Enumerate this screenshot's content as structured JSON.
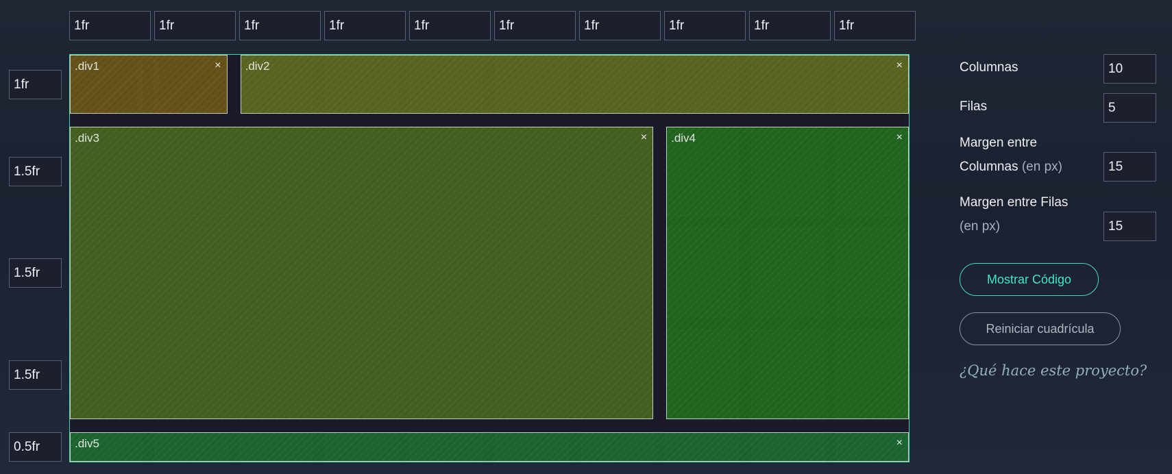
{
  "columns": {
    "templates": [
      "1fr",
      "1fr",
      "1fr",
      "1fr",
      "1fr",
      "1fr",
      "1fr",
      "1fr",
      "1fr",
      "1fr"
    ]
  },
  "rows": {
    "templates": [
      "1fr",
      "1.5fr",
      "1.5fr",
      "1.5fr",
      "0.5fr"
    ]
  },
  "grid": {
    "areas": [
      {
        "label": ".div1",
        "close": "×",
        "color": "#6a5618",
        "col": [
          1,
          2
        ],
        "row": [
          1,
          1
        ]
      },
      {
        "label": ".div2",
        "close": "×",
        "color": "#5c6a1f",
        "col": [
          3,
          10
        ],
        "row": [
          1,
          1
        ]
      },
      {
        "label": ".div3",
        "close": "×",
        "color": "#47651e",
        "col": [
          1,
          7
        ],
        "row": [
          2,
          4
        ]
      },
      {
        "label": ".div4",
        "close": "×",
        "color": "#216a1f",
        "col": [
          8,
          10
        ],
        "row": [
          2,
          4
        ]
      },
      {
        "label": ".div5",
        "close": "×",
        "color": "#1b6a30",
        "col": [
          1,
          10
        ],
        "row": [
          5,
          5
        ]
      }
    ]
  },
  "settings": {
    "columns_label": "Columnas",
    "columns_value": "10",
    "rows_label": "Filas",
    "rows_value": "5",
    "col_gap_label_line1": "Margen entre",
    "col_gap_label_line2": "Columnas",
    "col_gap_unit": "(en px)",
    "col_gap_value": "15",
    "row_gap_label_line1": "Margen entre Filas",
    "row_gap_unit": "(en px)",
    "row_gap_value": "15"
  },
  "buttons": {
    "show_code": "Mostrar Código",
    "reset": "Reiniciar cuadrícula"
  },
  "help_link": "¿Qué hace este proyecto?"
}
